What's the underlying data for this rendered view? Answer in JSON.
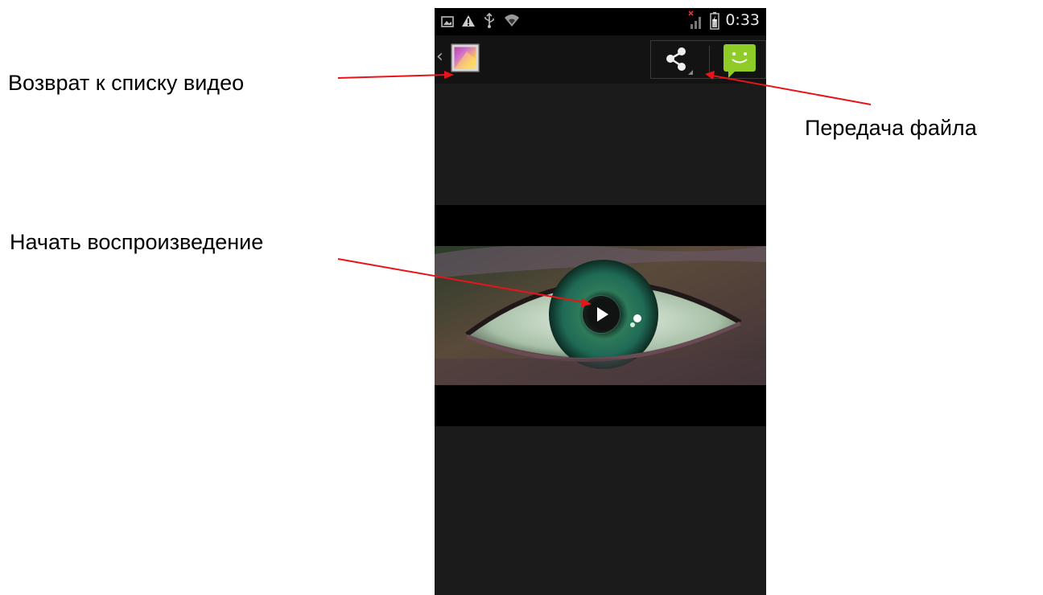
{
  "status_bar": {
    "time": "0:33",
    "icons": [
      "picture-icon",
      "warning-icon",
      "usb-icon",
      "wifi-icon",
      "no-signal-icon",
      "battery-icon"
    ]
  },
  "action_bar": {
    "back_icon": "chevron-left-icon",
    "app_icon": "gallery-icon",
    "share_icon": "share-icon",
    "message_icon": "message-icon"
  },
  "video": {
    "play_icon": "play-icon"
  },
  "annotations": {
    "back_label": "Возврат к списку видео",
    "share_label": "Передача файла",
    "play_label": "Начать воспроизведение"
  },
  "colors": {
    "annotation_arrow": "#e8141a",
    "message_app": "#8fcc28",
    "phone_background": "#1b1b1b"
  }
}
